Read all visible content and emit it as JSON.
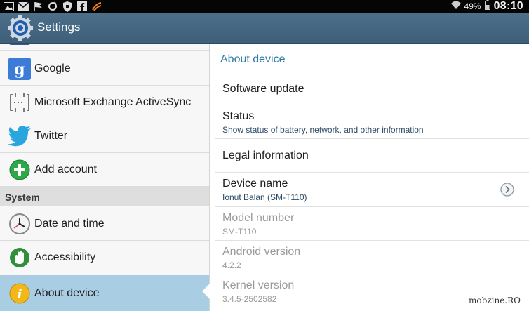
{
  "status_bar": {
    "battery": "49%",
    "time": "08:10",
    "left_icons": [
      "image-icon",
      "gmail-icon",
      "flag-icon",
      "sync-icon",
      "shield-icon",
      "facebook-icon",
      "swipe-icon"
    ]
  },
  "action_bar": {
    "title": "Settings",
    "icon": "settings-gear-icon"
  },
  "sidebar": {
    "items": [
      {
        "label": "Google",
        "icon": "google-icon"
      },
      {
        "label": "Microsoft Exchange ActiveSync",
        "icon": "exchange-icon"
      },
      {
        "label": "Twitter",
        "icon": "twitter-icon"
      },
      {
        "label": "Add account",
        "icon": "add-account-icon"
      }
    ],
    "section_header": "System",
    "system_items": [
      {
        "label": "Date and time",
        "icon": "clock-icon"
      },
      {
        "label": "Accessibility",
        "icon": "hand-icon"
      },
      {
        "label": "About device",
        "icon": "info-icon",
        "selected": true
      }
    ]
  },
  "detail": {
    "title": "About device",
    "items": [
      {
        "title": "Software update",
        "subtitle": ""
      },
      {
        "title": "Status",
        "subtitle": "Show status of battery, network, and other information"
      },
      {
        "title": "Legal information",
        "subtitle": ""
      },
      {
        "title": "Device name",
        "subtitle": "Ionut Balan (SM-T110)"
      },
      {
        "title": "Model number",
        "subtitle": "SM-T110"
      },
      {
        "title": "Android version",
        "subtitle": "4.2.2"
      },
      {
        "title": "Kernel version",
        "subtitle": "3.4.5-2502582"
      }
    ]
  },
  "watermark": "mobzine.RO",
  "colors": {
    "action_bar": "#45677f",
    "accent_title": "#2c7aa6",
    "selected_row": "#a9cde3",
    "section_header": "#dedede"
  }
}
